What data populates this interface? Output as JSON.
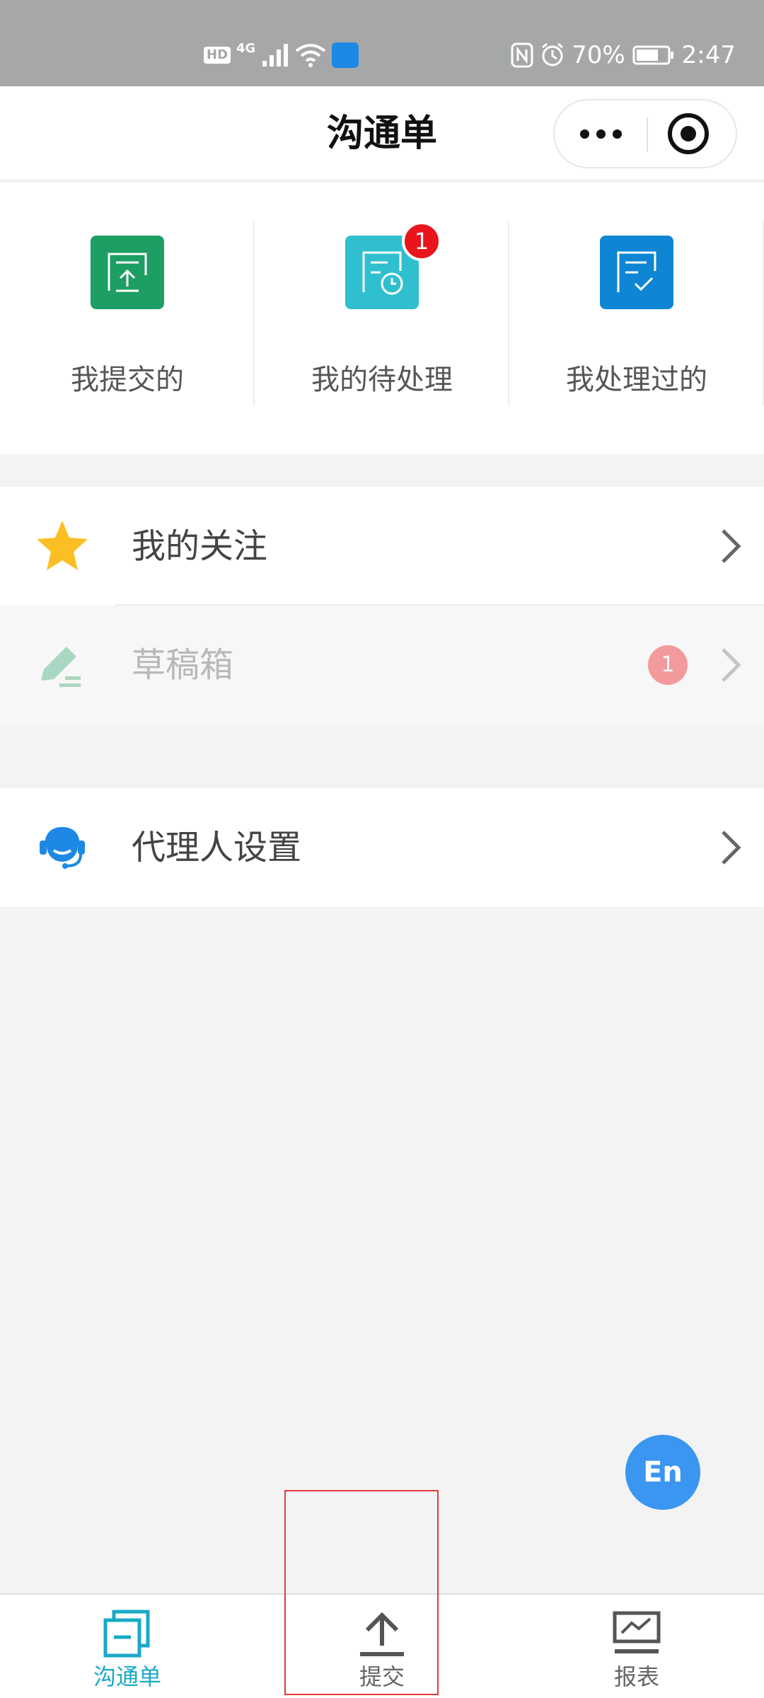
{
  "status_bar": {
    "hd": "HD",
    "network": "4G",
    "battery": "70%",
    "time": "2:47"
  },
  "nav": {
    "title": "沟通单"
  },
  "tiles": [
    {
      "label": "我提交的",
      "color": "#1d9e63",
      "icon": "submit-icon"
    },
    {
      "label": "我的待处理",
      "color": "#30bfcf",
      "icon": "pending-icon",
      "badge": "1"
    },
    {
      "label": "我处理过的",
      "color": "#0e86d4",
      "icon": "processed-icon"
    }
  ],
  "rows": [
    {
      "label": "我的关注",
      "icon": "star-icon",
      "icon_color": "#fbbf24"
    },
    {
      "label": "草稿箱",
      "icon": "edit-icon",
      "icon_color": "#1d9e63",
      "badge": "1",
      "disabled": true
    },
    {
      "label": "代理人设置",
      "icon": "support-agent-icon",
      "icon_color": "#1e88e5"
    }
  ],
  "lang_button": "En",
  "tab_bar": {
    "items": [
      {
        "label": "沟通单",
        "icon": "ticket-icon",
        "active": true
      },
      {
        "label": "提交",
        "icon": "upload-icon",
        "active": false
      },
      {
        "label": "报表",
        "icon": "report-icon",
        "active": false
      }
    ],
    "active_color": "#1aa9c7"
  }
}
